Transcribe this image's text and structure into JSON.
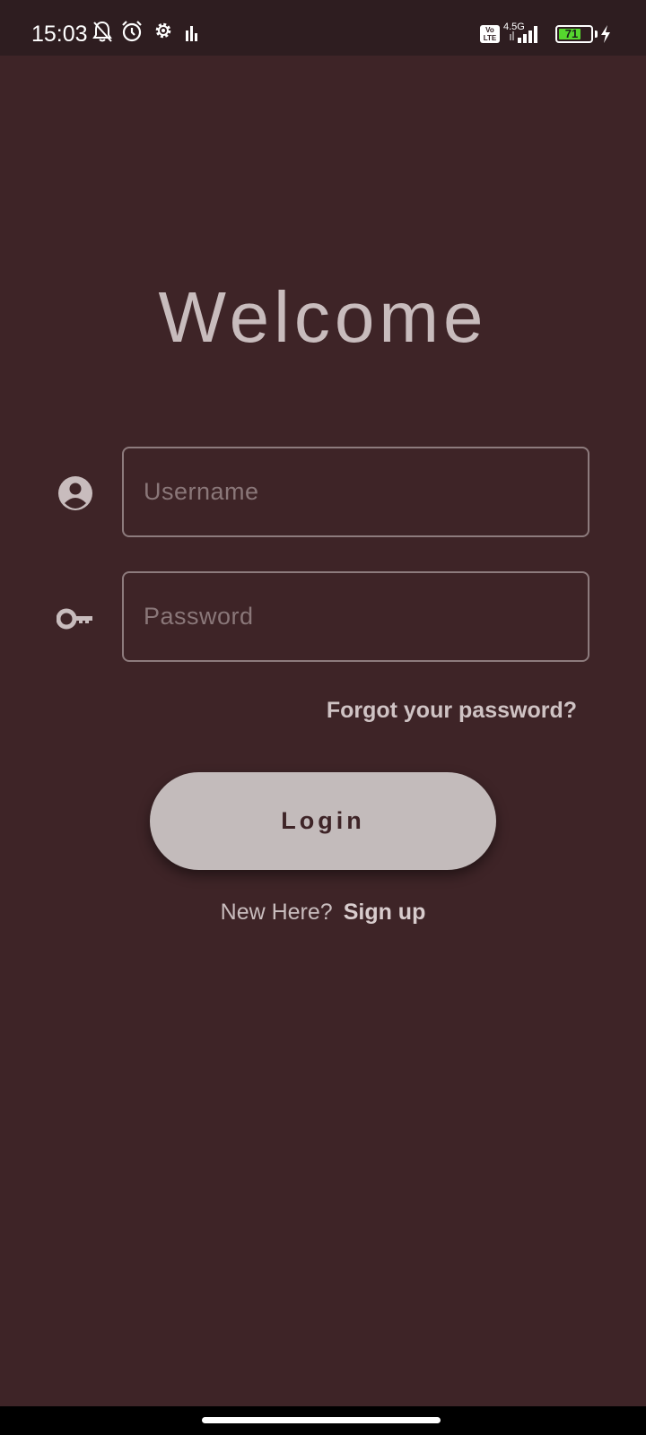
{
  "status_bar": {
    "time": "15:03",
    "icons": [
      "bell-off-icon",
      "alarm-icon",
      "settings-gear-icon",
      "bar-stats-icon",
      "volte-icon",
      "signal-icon",
      "battery-icon",
      "charging-icon"
    ],
    "volte_line1": "Vo",
    "volte_line2": "LTE",
    "network": "4.5G",
    "battery_level": "71",
    "battery_fraction": 0.71,
    "battery_color": "#55d62e"
  },
  "login": {
    "title": "Welcome",
    "username_placeholder": "Username",
    "username_value": "",
    "password_placeholder": "Password",
    "password_value": "",
    "forgot_label": "Forgot your password?",
    "login_label": "Login",
    "new_here_label": "New Here?",
    "signup_label": "Sign up"
  },
  "colors": {
    "background": "#3e2427",
    "status_bar": "#2e1d20",
    "text_light": "#c8bcbd",
    "button_fill": "#c3bbbb"
  }
}
